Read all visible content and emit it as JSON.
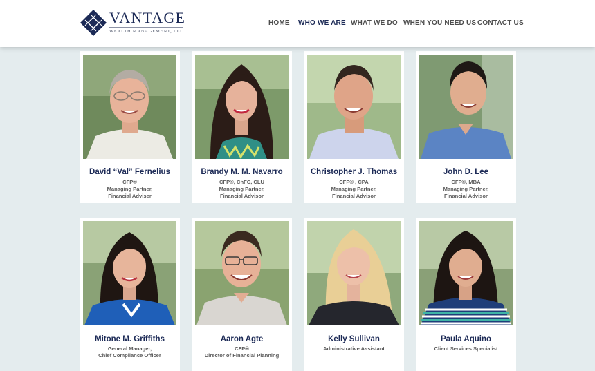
{
  "brand": {
    "name": "VANTAGE",
    "tagline": "WEALTH MANAGEMENT, LLC",
    "color": "#1c2a56"
  },
  "nav": {
    "items": [
      {
        "label": "HOME",
        "active": false
      },
      {
        "label": "WHO WE ARE",
        "active": true
      },
      {
        "label": "WHAT WE DO",
        "active": false
      },
      {
        "label": "WHEN YOU NEED US",
        "active": false
      },
      {
        "label": "CONTACT US",
        "active": false
      }
    ]
  },
  "team": [
    {
      "name": "David “Val” Fernelius",
      "lines": [
        "CFP®",
        "Managing Partner,",
        "Financial Adviser"
      ],
      "photo": "portrait-man-gray-hair-glasses"
    },
    {
      "name": "Brandy M. M. Navarro",
      "lines": [
        "CFP®, ChFC, CLU",
        "Managing Partner,",
        "Financial Advisor"
      ],
      "photo": "portrait-woman-long-dark-hair"
    },
    {
      "name": "Christopher J. Thomas",
      "lines": [
        "CFP® , CPA",
        "Managing Partner,",
        "Financial Advisor"
      ],
      "photo": "portrait-man-dark-hair"
    },
    {
      "name": "John D. Lee",
      "lines": [
        "CFP®, MBA",
        "Managing Partner,",
        "Financial Advisor"
      ],
      "photo": "portrait-man-blue-shirt"
    },
    {
      "name": "Mitone M. Griffiths",
      "lines": [
        "General Manager,",
        "Chief Compliance Officer"
      ],
      "photo": "portrait-woman-blue-top"
    },
    {
      "name": "Aaron Agte",
      "lines": [
        "CFP®",
        "Director of Financial Planning"
      ],
      "photo": "portrait-man-glasses"
    },
    {
      "name": "Kelly Sullivan",
      "lines": [
        "Administrative Assistant"
      ],
      "photo": "portrait-woman-blonde"
    },
    {
      "name": "Paula Aquino",
      "lines": [
        "Client Services Specialist"
      ],
      "photo": "portrait-woman-striped-top"
    }
  ]
}
